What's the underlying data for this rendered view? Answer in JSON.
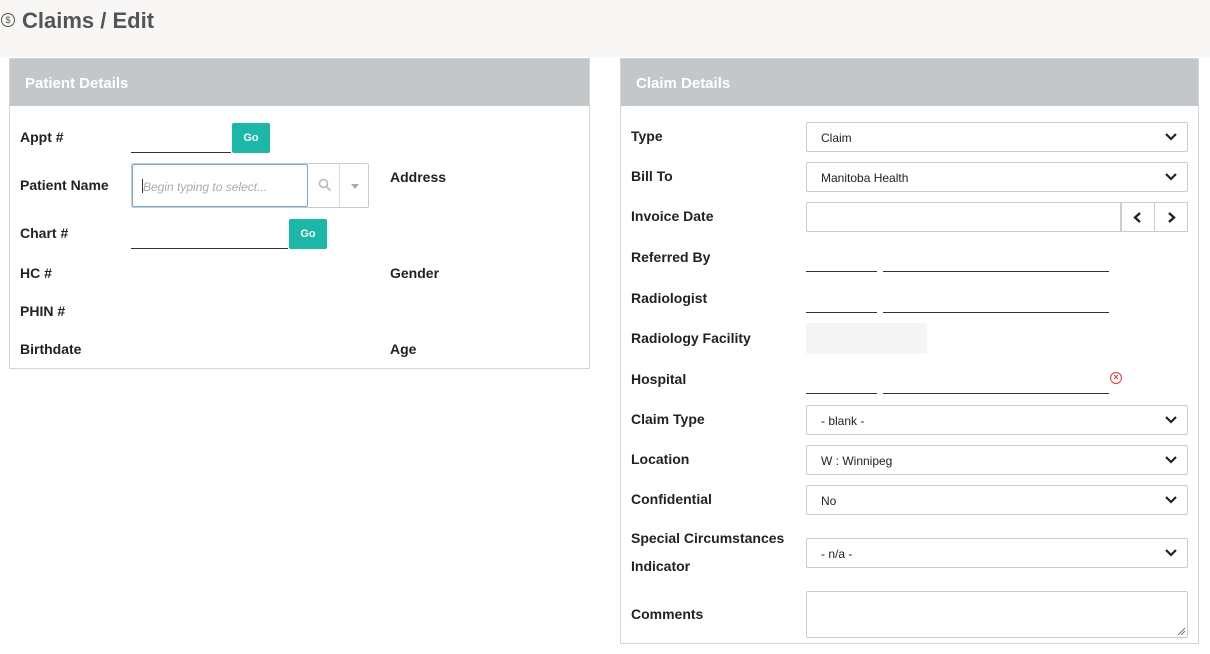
{
  "page": {
    "title": "Claims / Edit",
    "title_icon": "dollar-circle-icon"
  },
  "patient": {
    "heading": "Patient Details",
    "appt_label": "Appt #",
    "go_label": "Go",
    "patient_name_label": "Patient Name",
    "patient_name_placeholder": "Begin typing to select...",
    "address_label": "Address",
    "chart_label": "Chart #",
    "hc_label": "HC #",
    "gender_label": "Gender",
    "phin_label": "PHIN #",
    "birthdate_label": "Birthdate",
    "age_label": "Age"
  },
  "claim": {
    "heading": "Claim Details",
    "type_label": "Type",
    "type_value": "Claim",
    "bill_to_label": "Bill To",
    "bill_to_value": "Manitoba Health",
    "invoice_date_label": "Invoice Date",
    "invoice_date_value": "",
    "referred_by_label": "Referred By",
    "radiologist_label": "Radiologist",
    "radiology_facility_label": "Radiology Facility",
    "hospital_label": "Hospital",
    "claim_type_label": "Claim Type",
    "claim_type_value": "- blank -",
    "location_label": "Location",
    "location_value": "W : Winnipeg",
    "confidential_label": "Confidential",
    "confidential_value": "No",
    "special_label_line1": "Special Circumstances",
    "special_label_line2": "Indicator",
    "special_value": "- n/a -",
    "comments_label": "Comments",
    "comments_value": ""
  },
  "colors": {
    "accent": "#1bb8a8",
    "panel_header": "#c4c7ca",
    "error": "#ee3333"
  }
}
